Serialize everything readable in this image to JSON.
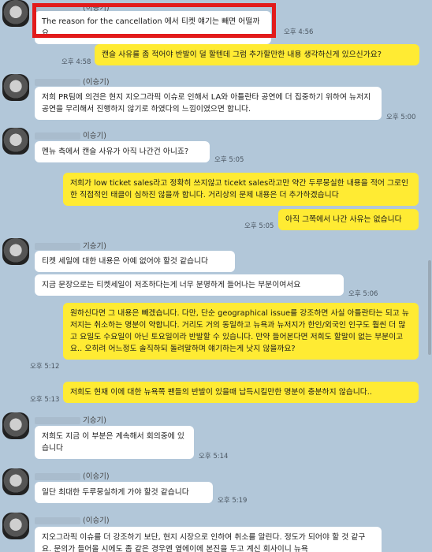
{
  "messages": [
    {
      "sender": "(이승기)",
      "text": "The reason for the cancellation 에서 티켓 얘기는 빼면 어떨까요",
      "time": "오후 4:56"
    },
    {
      "text": "캔슬 사유를 좀 적어야 반발이 덜 할텐데 그럼 추가할만한 내용 생각하신게 있으신가요?",
      "time": "오후 4:58"
    },
    {
      "sender": "(이승기)",
      "text": "저희 PR팀에 의견은 현지 지오그라픽 이슈로 인해서 LA와 아틀란타 공연에 더 집중하기 위하여 뉴저지 공연을 무리해서 진행하지 않기로 하였다의 느낌이였으면 합니다.",
      "time": "오후 5:00"
    },
    {
      "sender": "이승기)",
      "text": "멘뉴 측에서 캔슬 사유가 아직 나간건 아니죠?",
      "time": "오후 5:05"
    },
    {
      "text": "저희가 low ticket sales라고 정확히 쓰지않고 ticekt sales라고만 약간 두루뭉실한 내용을 적어 그로인한 직접적인 태클이 심하진 않을까 합니다. 거리상의 문제 내용은 더 추가하겠습니다",
      "time": ""
    },
    {
      "text": "아직 그쪽에서 나간 사유는 없습니다",
      "time": "오후 5:05"
    },
    {
      "sender": "기승기)",
      "text": "티켓 세일에 대한 내용은 아예 없어야 할것 같습니다",
      "time": ""
    },
    {
      "text": "지금 문장으로는 티켓세일이 저조하다는게 너무 분명하게 들어나는 부분이여서요",
      "time": "오후 5:06"
    },
    {
      "text": "원하신다면 그 내용은 빼겠습니다. 다만, 단순 geographical issue를 강조하면 사실 아틀란타는 되고 뉴저지는 취소하는 명분이 약합니다. 거리도 거의 동일하고 뉴욕과 뉴저지가 한인/외국인 인구도 훨씬 더 많고 요일도 수요일이 아닌 토요일이라 반발할 수 있습니다. 만약 들어본다면 저희도 할말이 없는 부분이고요.. 오히려 어느정도 솔직하되 돌려말하며 얘기하는게 낫지 않을까요?",
      "time": "오후 5:12"
    },
    {
      "text": "저희도 현재 이에 대한 뉴욕쪽 팬들의 반발이 있을때 납득시킬만한 명분이 충분하지 않습니다..",
      "time": "오후 5:13"
    },
    {
      "sender": "기승기)",
      "text": "저희도 지금 이 부분은 계속해서 회의중에 있습니다",
      "time": "오후 5:14"
    },
    {
      "sender": "(이승기)",
      "text": "일단 최대한 두루뭉실하게 가야 할것 같습니다",
      "time": "오후 5:19"
    },
    {
      "sender": "(이승기)",
      "text": "지오그라픽 이슈를 더 강조하기 보단, 현지 시장으로 인하여 취소를 알린다. 정도가 되어야 할 것 같구요. 문의가 들어올 시에도 좀 같은 경우엔 옆에이에 본진을 두고 계신 회사이니 뉴욕",
      "time": ""
    }
  ]
}
